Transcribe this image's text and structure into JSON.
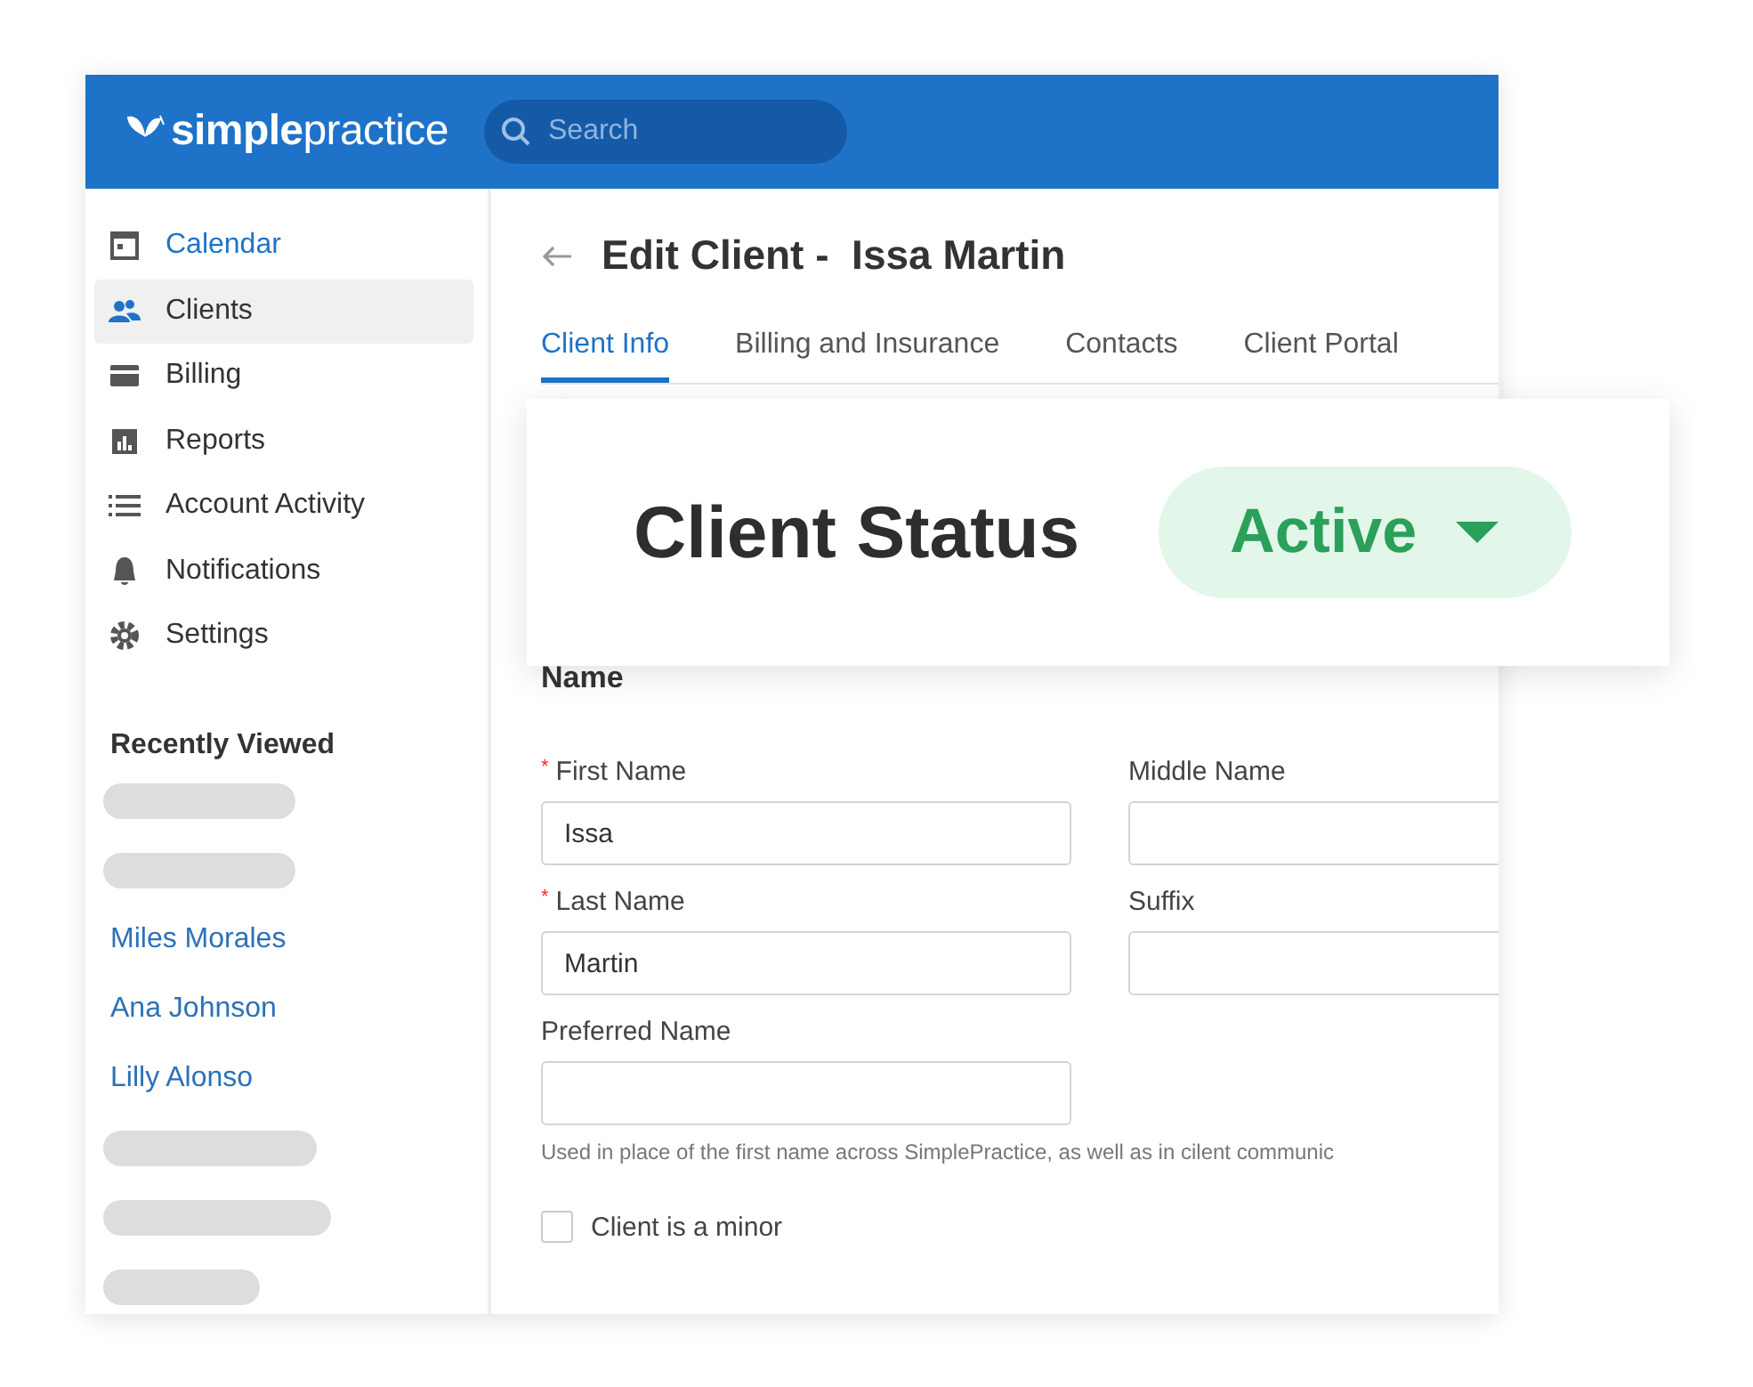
{
  "header": {
    "logo": "**simple**practice",
    "search": {
      "placeholder": "Search"
    }
  },
  "sidebar": {
    "items": [
      {
        "label": "Calendar",
        "selected": false,
        "hovered": true
      },
      {
        "label": "Clients",
        "selected": true,
        "hovered": false
      },
      {
        "label": "Billing",
        "selected": false,
        "hovered": false
      },
      {
        "label": "Reports",
        "selected": false,
        "hovered": false
      },
      {
        "label": "Account Activity",
        "selected": false,
        "hovered": false
      },
      {
        "label": "Notifications",
        "selected": false,
        "hovered": false
      },
      {
        "label": "Settings",
        "selected": false,
        "hovered": false
      }
    ],
    "recently_viewed": {
      "title": "Recently Viewed",
      "items": [
        {
          "kind": "placeholder"
        },
        {
          "kind": "placeholder"
        },
        {
          "kind": "link",
          "label": "Miles Morales"
        },
        {
          "kind": "link",
          "label": "Ana Johnson"
        },
        {
          "kind": "link",
          "label": "Lilly Alonso"
        },
        {
          "kind": "placeholder"
        },
        {
          "kind": "placeholder"
        },
        {
          "kind": "placeholder"
        }
      ]
    }
  },
  "main": {
    "title": "Edit Client -  Issa Martin",
    "tabs": [
      {
        "label": "Client Info",
        "selected": true
      },
      {
        "label": "Billing and Insurance",
        "selected": false
      },
      {
        "label": "Contacts",
        "selected": false
      },
      {
        "label": "Client Portal",
        "selected": false
      }
    ],
    "status_card": {
      "title": "Client Status",
      "status": "Active"
    },
    "section": "Name",
    "fields": [
      {
        "label": "First Name",
        "required_mark": "*",
        "value": "Issa"
      },
      {
        "label": "Middle Name"
      },
      {
        "label": "Last Name",
        "required_mark": "*",
        "value": "Martin"
      },
      {
        "label": "Suffix"
      },
      {
        "label": "Preferred Name"
      }
    ],
    "helper": "Used in place of the first name across SimplePractice, as well as in cilent communic",
    "minor_checkbox": {
      "label": "Client is a minor",
      "checked": false
    }
  }
}
